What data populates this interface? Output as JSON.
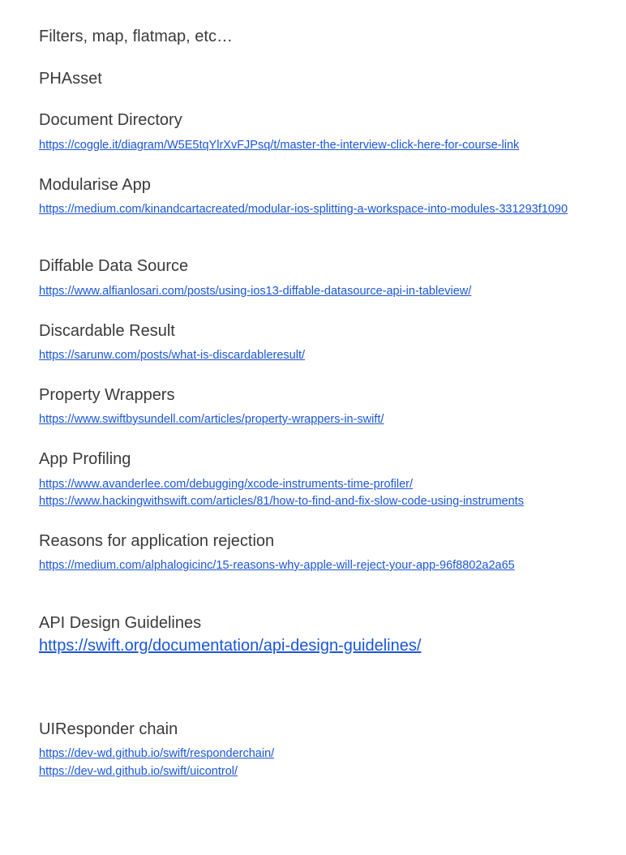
{
  "sections": [
    {
      "heading": "Filters, map, flatmap, etc…"
    },
    {
      "heading": "PHAsset"
    },
    {
      "heading": "Document Directory",
      "links": [
        "https://coggle.it/diagram/W5E5tqYlrXvFJPsq/t/master-the-interview-click-here-for-course-link"
      ]
    },
    {
      "heading": "Modularise App",
      "links": [
        "https://medium.com/kinandcartacreated/modular-ios-splitting-a-workspace-into-modules-331293f1090"
      ]
    },
    {
      "heading": "Diffable Data Source",
      "links": [
        "https://www.alfianlosari.com/posts/using-ios13-diffable-datasource-api-in-tableview/"
      ]
    },
    {
      "heading": "Discardable Result",
      "links": [
        "https://sarunw.com/posts/what-is-discardableresult/"
      ]
    },
    {
      "heading": "Property Wrappers",
      "links": [
        "https://www.swiftbysundell.com/articles/property-wrappers-in-swift/"
      ]
    },
    {
      "heading": "App Profiling",
      "links": [
        "https://www.avanderlee.com/debugging/xcode-instruments-time-profiler/",
        "https://www.hackingwithswift.com/articles/81/how-to-find-and-fix-slow-code-using-instruments"
      ]
    },
    {
      "heading": "Reasons for application rejection",
      "links": [
        "https://medium.com/alphalogicinc/15-reasons-why-apple-will-reject-your-app-96f8802a2a65"
      ]
    },
    {
      "heading": "API Design Guidelines",
      "links": [
        "https://swift.org/documentation/api-design-guidelines/"
      ]
    },
    {
      "heading": "UIResponder chain",
      "links": [
        "https://dev-wd.github.io/swift/responderchain/",
        "https://dev-wd.github.io/swift/uicontrol/"
      ]
    }
  ]
}
